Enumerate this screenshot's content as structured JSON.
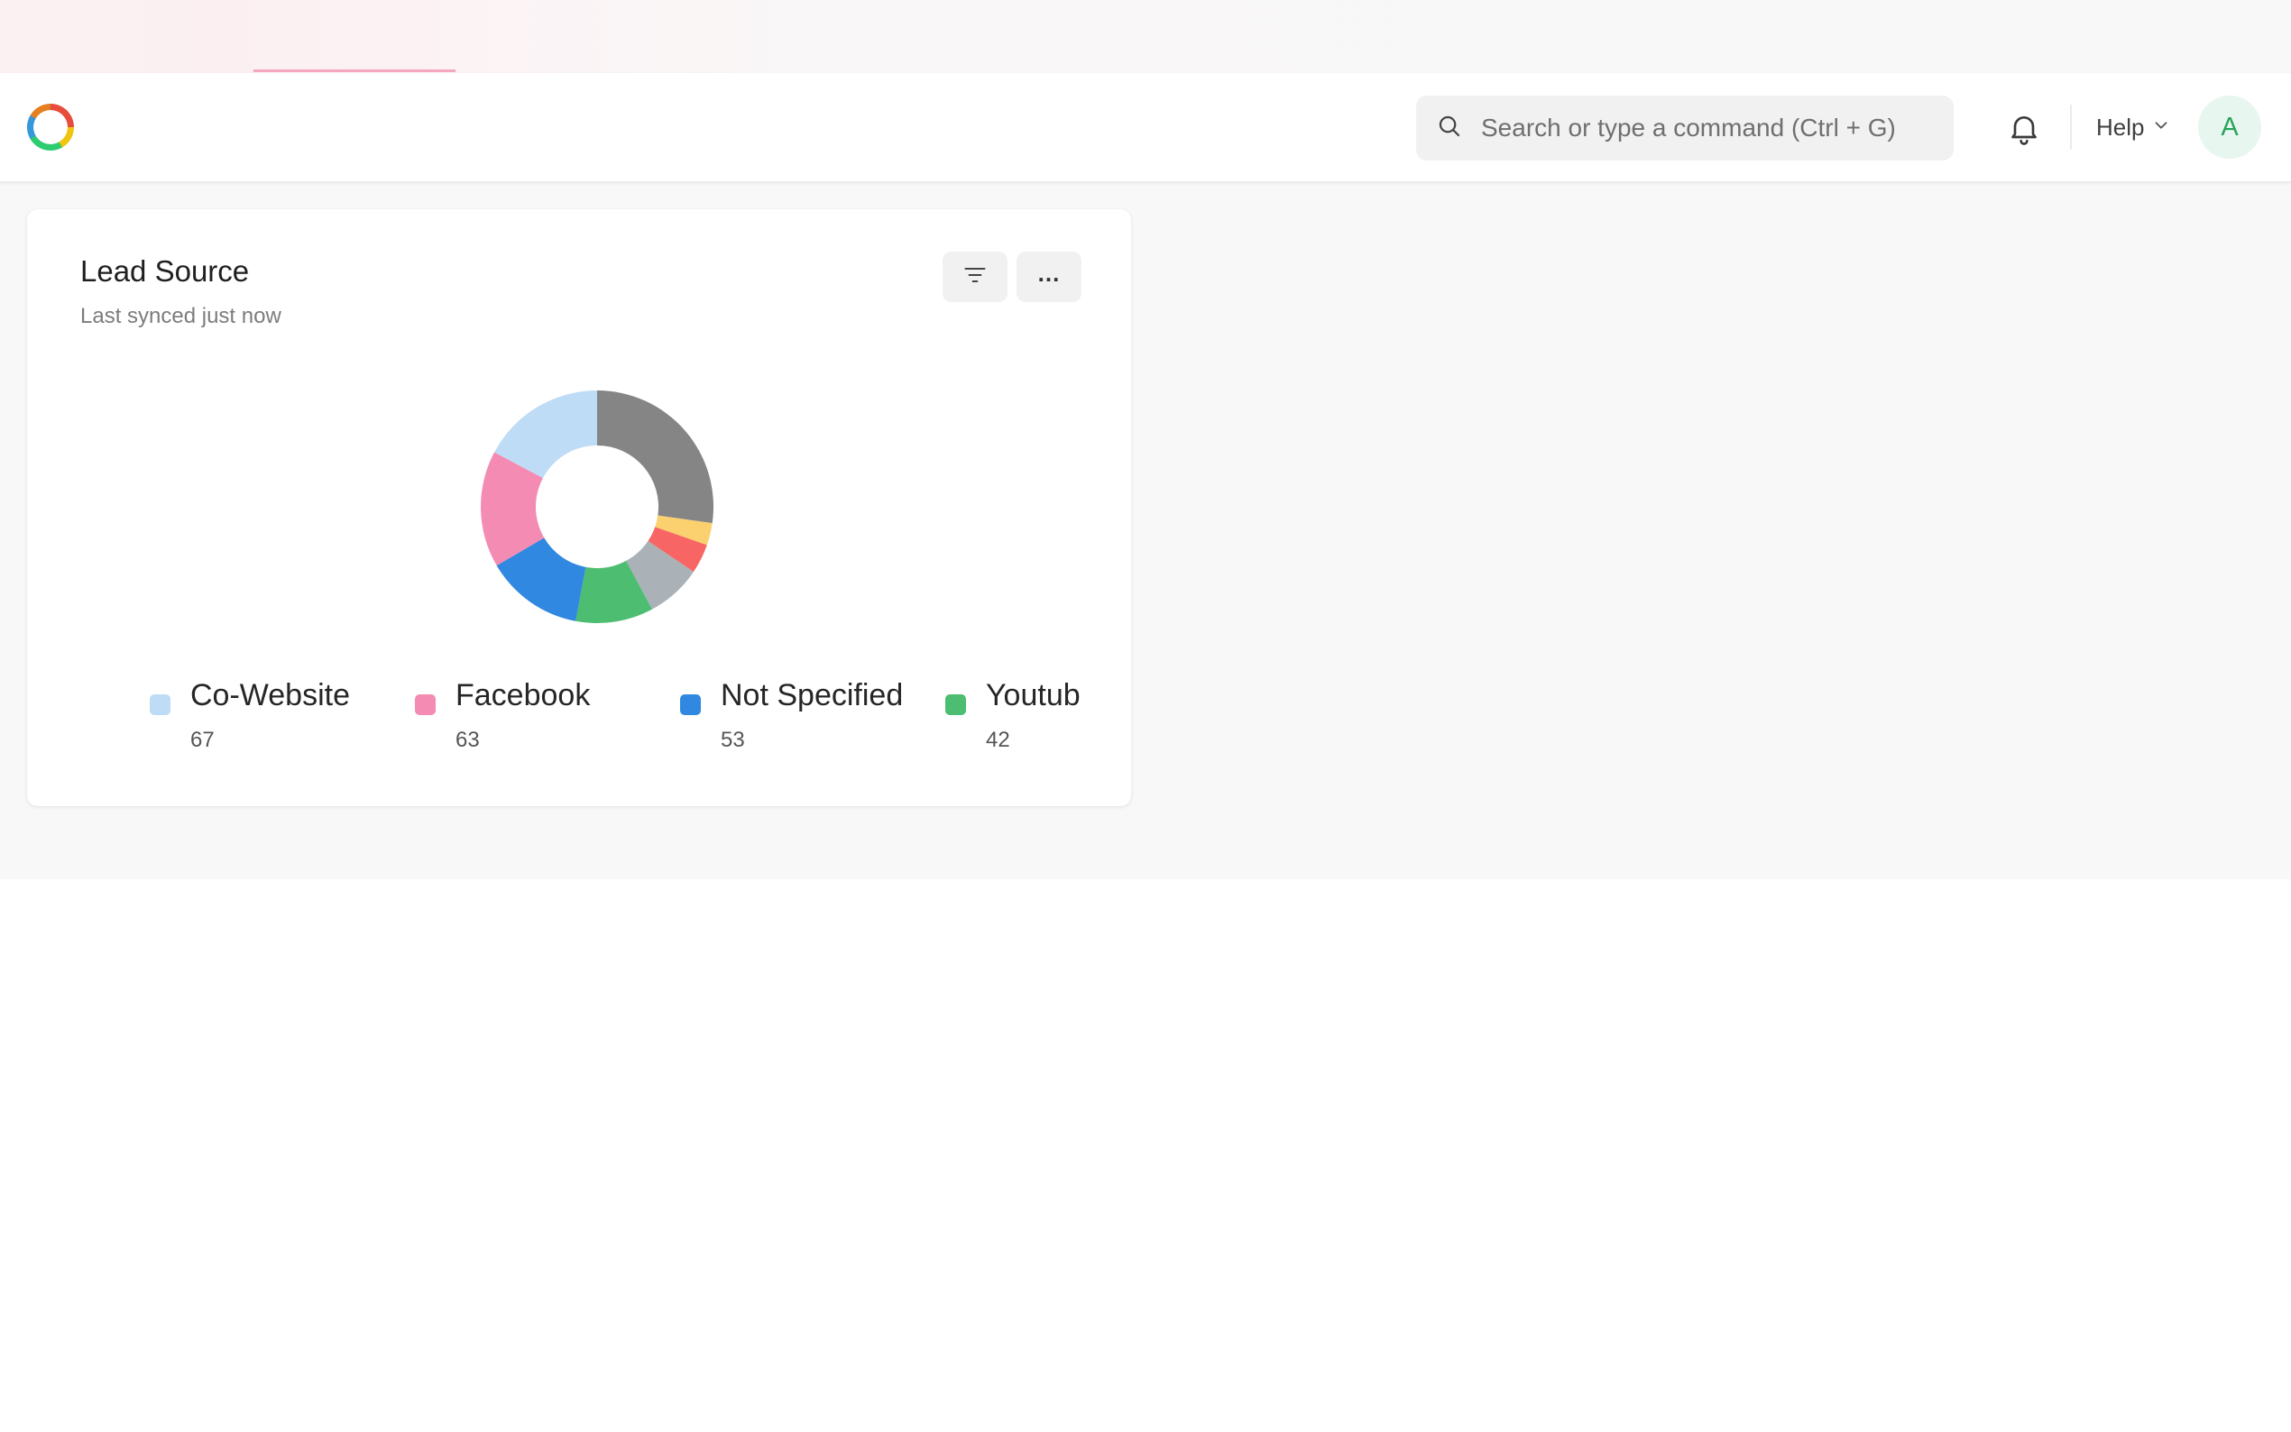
{
  "navbar": {
    "search_placeholder": "Search or type a command (Ctrl + G)",
    "help_label": "Help",
    "avatar_initial": "A"
  },
  "card": {
    "title": "Lead Source",
    "subtitle": "Last synced just now",
    "more_label": "..."
  },
  "chart_data": {
    "type": "pie",
    "title": "Lead Source",
    "categories": [
      "Co-Website",
      "Facebook",
      "Not Specified",
      "Youtub",
      "",
      "",
      "",
      ""
    ],
    "values": [
      67,
      63,
      53,
      42,
      30,
      16,
      12,
      106
    ],
    "colors": [
      "#bfdcf6",
      "#f48bb3",
      "#3188e0",
      "#4cbd71",
      "#aab2b8",
      "#f76664",
      "#fad16e",
      "#858585"
    ],
    "legend_items": [
      {
        "label": "Co-Website",
        "value": "67",
        "color": "#bfdcf6"
      },
      {
        "label": "Facebook",
        "value": "63",
        "color": "#f48bb3"
      },
      {
        "label": "Not Specified",
        "value": "53",
        "color": "#3188e0"
      },
      {
        "label": "Youtub",
        "value": "42",
        "color": "#4cbd71"
      }
    ],
    "legend": "bottom"
  }
}
